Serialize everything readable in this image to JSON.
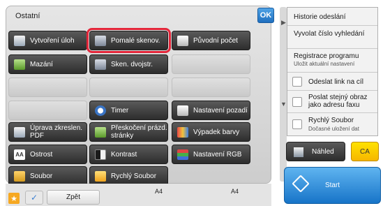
{
  "panel": {
    "title": "Ostatní",
    "ok_label": "OK"
  },
  "functions": [
    {
      "id": "vytvoreni",
      "label": "Vytvoření úloh",
      "icon": "document-stack-icon"
    },
    {
      "id": "pomale",
      "label": "Pomalé skenov.",
      "icon": "slow-scan-icon",
      "selected": true
    },
    {
      "id": "puvodni",
      "label": "Původní počet",
      "icon": "original-count-icon"
    },
    {
      "id": "mazani",
      "label": "Mazání",
      "icon": "erase-icon"
    },
    {
      "id": "sken",
      "label": "Sken. dvojstr.",
      "icon": "dual-page-scan-icon"
    },
    {
      "id": "timer",
      "label": "Timer",
      "icon": "clock-icon"
    },
    {
      "id": "nastaveni-pozadi",
      "label": "Nastavení pozadí",
      "icon": "background-icon"
    },
    {
      "id": "uprava",
      "label": "Úprava zkreslen. PDF",
      "icon": "pdf-skew-icon"
    },
    {
      "id": "preskoceni",
      "label": "Přeskočení prázd. stránky",
      "icon": "blank-page-skip-icon"
    },
    {
      "id": "vypadek",
      "label": "Výpadek barvy",
      "icon": "color-dropout-icon"
    },
    {
      "id": "ostrost",
      "label": "Ostrost",
      "icon": "sharpness-icon"
    },
    {
      "id": "kontrast",
      "label": "Kontrast",
      "icon": "contrast-icon"
    },
    {
      "id": "rgb",
      "label": "Nastavení RGB",
      "icon": "rgb-icon"
    },
    {
      "id": "soubor",
      "label": "Soubor",
      "icon": "folder-icon"
    },
    {
      "id": "rychly",
      "label": "Rychlý Soubor",
      "icon": "quick-file-icon"
    }
  ],
  "right_panel": {
    "history": "Historie odeslání",
    "recall": "Vyvolat číslo vyhledání",
    "register": "Registrace programu",
    "register_sub": "Uložit aktuální nastavení",
    "send_link": "Odeslat link na cíl",
    "send_same": "Poslat stejný obraz jako adresu faxu",
    "quick_file": "Rychlý Soubor",
    "quick_file_sub": "Dočasné uložení dat"
  },
  "actions": {
    "preview": "Náhled",
    "ca": "CA",
    "start": "Start",
    "back": "Zpět"
  },
  "paper": {
    "left": "A4",
    "right": "A4"
  }
}
